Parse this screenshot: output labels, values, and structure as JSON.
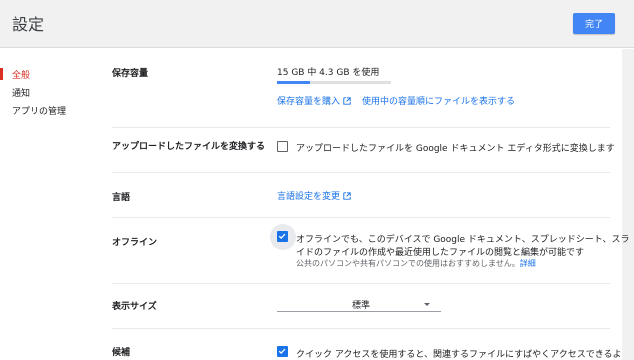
{
  "header": {
    "title": "設定",
    "done_label": "完了"
  },
  "sidebar": {
    "items": [
      {
        "label": "全般",
        "active": true
      },
      {
        "label": "通知",
        "active": false
      },
      {
        "label": "アプリの管理",
        "active": false
      }
    ]
  },
  "sections": {
    "storage": {
      "label": "保存容量",
      "usage": "15 GB 中 4.3 GB を使用",
      "used_fraction": 0.29,
      "buy_link": "保存容量を購入",
      "view_link": "使用中の容量順にファイルを表示する"
    },
    "convert": {
      "label": "アップロードしたファイルを変換する",
      "checkbox_label": "アップロードしたファイルを Google ドキュメント エディタ形式に変換します",
      "checked": false
    },
    "language": {
      "label": "言語",
      "link": "言語設定を変更"
    },
    "offline": {
      "label": "オフライン",
      "line1": "オフラインでも、このデバイスで Google ドキュメント、スプレッドシート、スラ",
      "line2": "イドのファイルの作成や最近使用したファイルの閲覧と編集が可能です",
      "note": "公共のパソコンや共有パソコンでの使用はおすすめしません。",
      "details_link": "詳細",
      "checked": true
    },
    "density": {
      "label": "表示サイズ",
      "value": "標準"
    },
    "suggestions": {
      "label": "候補",
      "checkbox_label": "クイック アクセスを使用すると、関連するファイルにすばやくアクセスできるよ",
      "checked": true
    }
  },
  "colors": {
    "accent": "#1a73e8",
    "button": "#4285f4",
    "active_nav": "#d93025"
  }
}
